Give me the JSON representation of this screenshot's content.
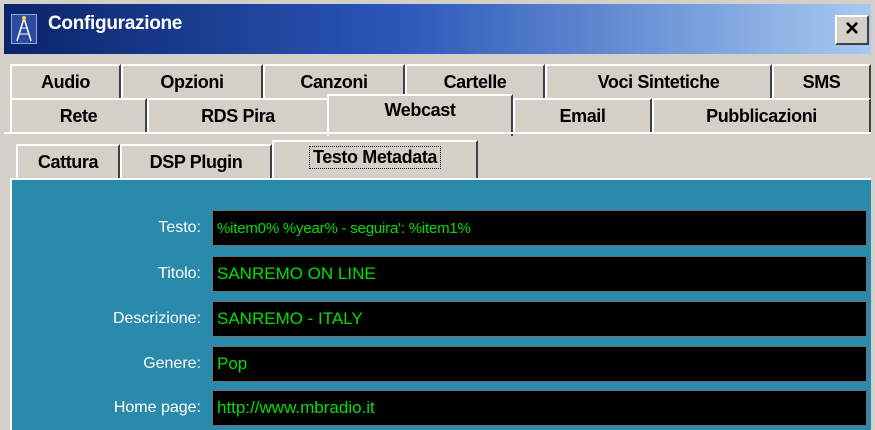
{
  "window": {
    "title": "Configurazione",
    "close_glyph": "×",
    "icon": "antenna-tower-icon"
  },
  "tabs": {
    "row1": [
      "Audio",
      "Opzioni",
      "Canzoni",
      "Cartelle",
      "Voci Sintetiche",
      "SMS"
    ],
    "row2": [
      "Rete",
      "RDS Pira",
      "Webcast",
      "Email",
      "Pubblicazioni"
    ],
    "selected": "Webcast"
  },
  "subtabs": {
    "items": [
      "Cattura",
      "DSP Plugin",
      "Testo Metadata"
    ],
    "selected": "Testo Metadata"
  },
  "metadata": {
    "fields": [
      {
        "label": "Testo:",
        "value": "%item0% %year% - seguira': %item1%"
      },
      {
        "label": "Titolo:",
        "value": "SANREMO ON LINE"
      },
      {
        "label": "Descrizione:",
        "value": "SANREMO - ITALY"
      },
      {
        "label": "Genere:",
        "value": "Pop"
      },
      {
        "label": "Home page:",
        "value": "http://www.mbradio.it"
      }
    ]
  },
  "colors": {
    "panel_bg": "#2a8aab",
    "field_bg": "#000000",
    "field_text": "#00e000",
    "titlebar_start": "#0a246a",
    "titlebar_end": "#a6caf0"
  }
}
